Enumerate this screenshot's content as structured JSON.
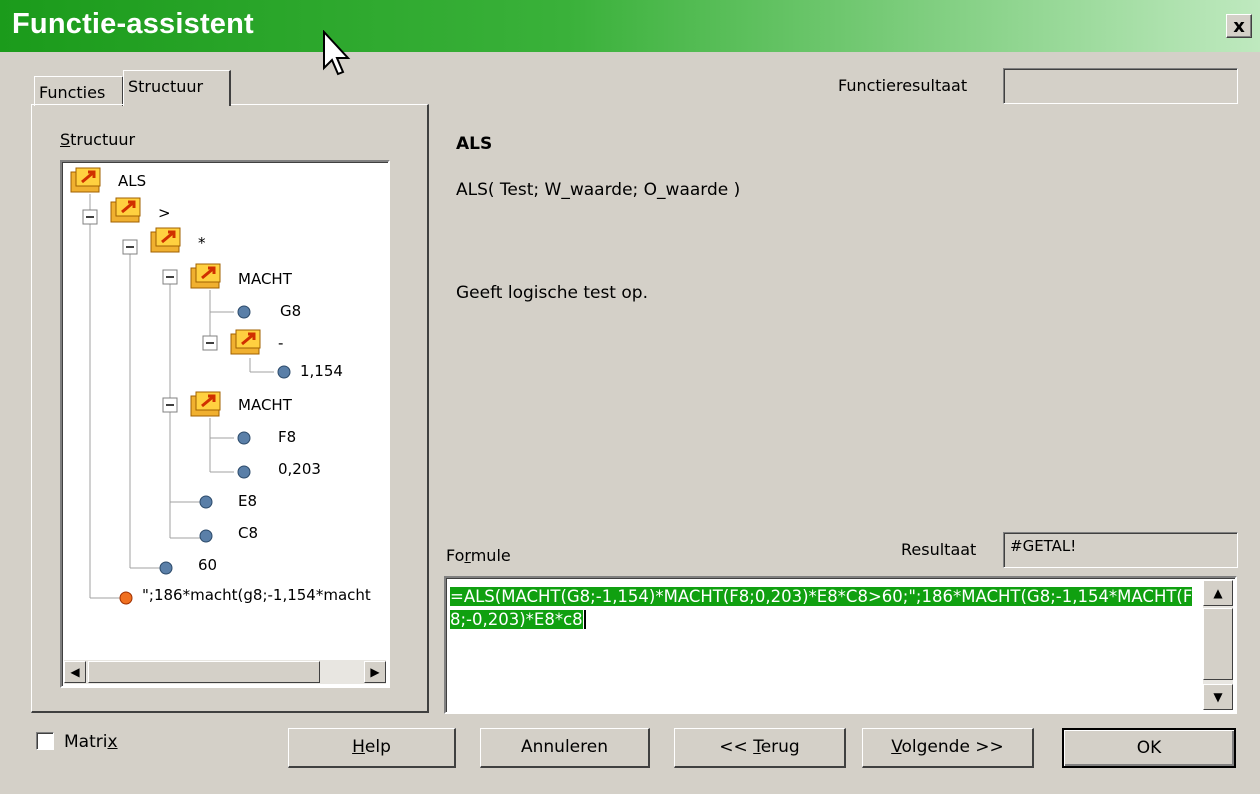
{
  "window": {
    "title": "Functie-assistent",
    "close_glyph": "x"
  },
  "tabs": [
    {
      "label": "Functies"
    },
    {
      "label": "Structuur"
    }
  ],
  "structure": {
    "label": "Structuur",
    "tree": [
      {
        "label": "ALS",
        "type": "folder"
      },
      {
        "label": ">",
        "type": "folder"
      },
      {
        "label": "*",
        "type": "folder"
      },
      {
        "label": "MACHT",
        "type": "folder"
      },
      {
        "label": "G8",
        "type": "value"
      },
      {
        "label": "-",
        "type": "folder"
      },
      {
        "label": "1,154",
        "type": "value"
      },
      {
        "label": "MACHT",
        "type": "folder"
      },
      {
        "label": "F8",
        "type": "value"
      },
      {
        "label": "0,203",
        "type": "value"
      },
      {
        "label": "E8",
        "type": "value"
      },
      {
        "label": "C8",
        "type": "value"
      },
      {
        "label": "60",
        "type": "value"
      },
      {
        "label": "\";186*macht(g8;-1,154*macht",
        "type": "error"
      }
    ]
  },
  "function_result": {
    "label": "Functieresultaat",
    "value": ""
  },
  "function_info": {
    "name": "ALS",
    "signature": "ALS( Test; W_waarde; O_waarde )",
    "description": "Geeft logische test op."
  },
  "formula": {
    "label": "Formule",
    "value": "=ALS(MACHT(G8;-1,154)*MACHT(F8;0,203)*E8*C8>60;\";186*MACHT(G8;-1,154*MACHT(F8;-0,203)*E8*c8"
  },
  "result": {
    "label": "Resultaat",
    "value": "#GETAL!"
  },
  "matrix": {
    "label": "Matrix",
    "checked": false
  },
  "buttons": {
    "help": "Help",
    "cancel": "Annuleren",
    "back": "<< Terug",
    "next": "Volgende >>",
    "ok": "OK"
  },
  "colors": {
    "title_green": "#1b9b1b",
    "selection_green": "#10a010",
    "dialog_bg": "#d4d0c8"
  }
}
